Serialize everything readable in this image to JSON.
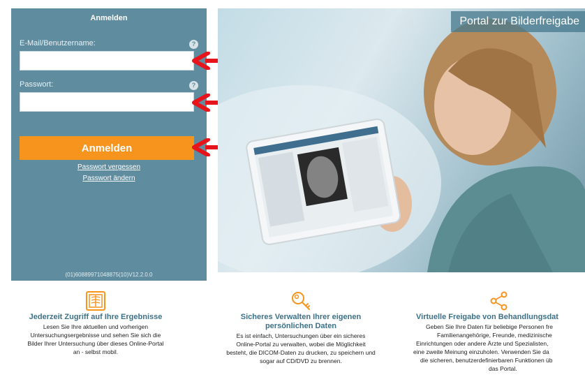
{
  "login": {
    "title": "Anmelden",
    "username_label": "E-Mail/Benutzername:",
    "username_value": "",
    "password_label": "Passwort:",
    "password_value": "",
    "submit_label": "Anmelden",
    "forgot_password": "Passwort vergessen",
    "change_password": "Passwort ändern",
    "version": "(01)60889971048875(10)V12.2.0.0"
  },
  "hero": {
    "banner": "Portal zur Bilderfreigabe"
  },
  "features": [
    {
      "icon": "xray-icon",
      "title_lines": [
        "Jederzeit Zugriff auf Ihre Ergebnisse"
      ],
      "text_lines": [
        "Lesen Sie Ihre aktuellen und vorherigen",
        "Untersuchungsergebnisse und sehen Sie sich die",
        "Bilder Ihrer Untersuchung über dieses Online-Portal",
        "an - selbst mobil."
      ]
    },
    {
      "icon": "key-icon",
      "title_lines": [
        "Sicheres Verwalten Ihrer eigenen",
        "persönlichen Daten"
      ],
      "text_lines": [
        "Es ist einfach, Untersuchungen über ein sicheres",
        "Online-Portal zu verwalten, wobei die Möglichkeit",
        "besteht, die DICOM-Daten zu drucken, zu speichern und",
        "sogar auf CD/DVD zu brennen."
      ]
    },
    {
      "icon": "share-icon",
      "title_lines": [
        "Virtuelle Freigabe von Behandlungsdat"
      ],
      "text_lines": [
        "Geben Sie Ihre Daten für beliebige Personen fre",
        "Familienangehörige, Freunde, medizinische",
        "Einrichtungen oder andere Ärzte und Spezialisten,",
        "eine zweite Meinung einzuholen. Verwenden Sie da",
        "die sicheren, benutzerdefinierbaren Funktionen üb",
        "das Portal."
      ]
    }
  ],
  "colors": {
    "panel": "#5f8c9e",
    "accent": "#f7941d",
    "title": "#3c7187",
    "arrow": "#e8141b"
  }
}
